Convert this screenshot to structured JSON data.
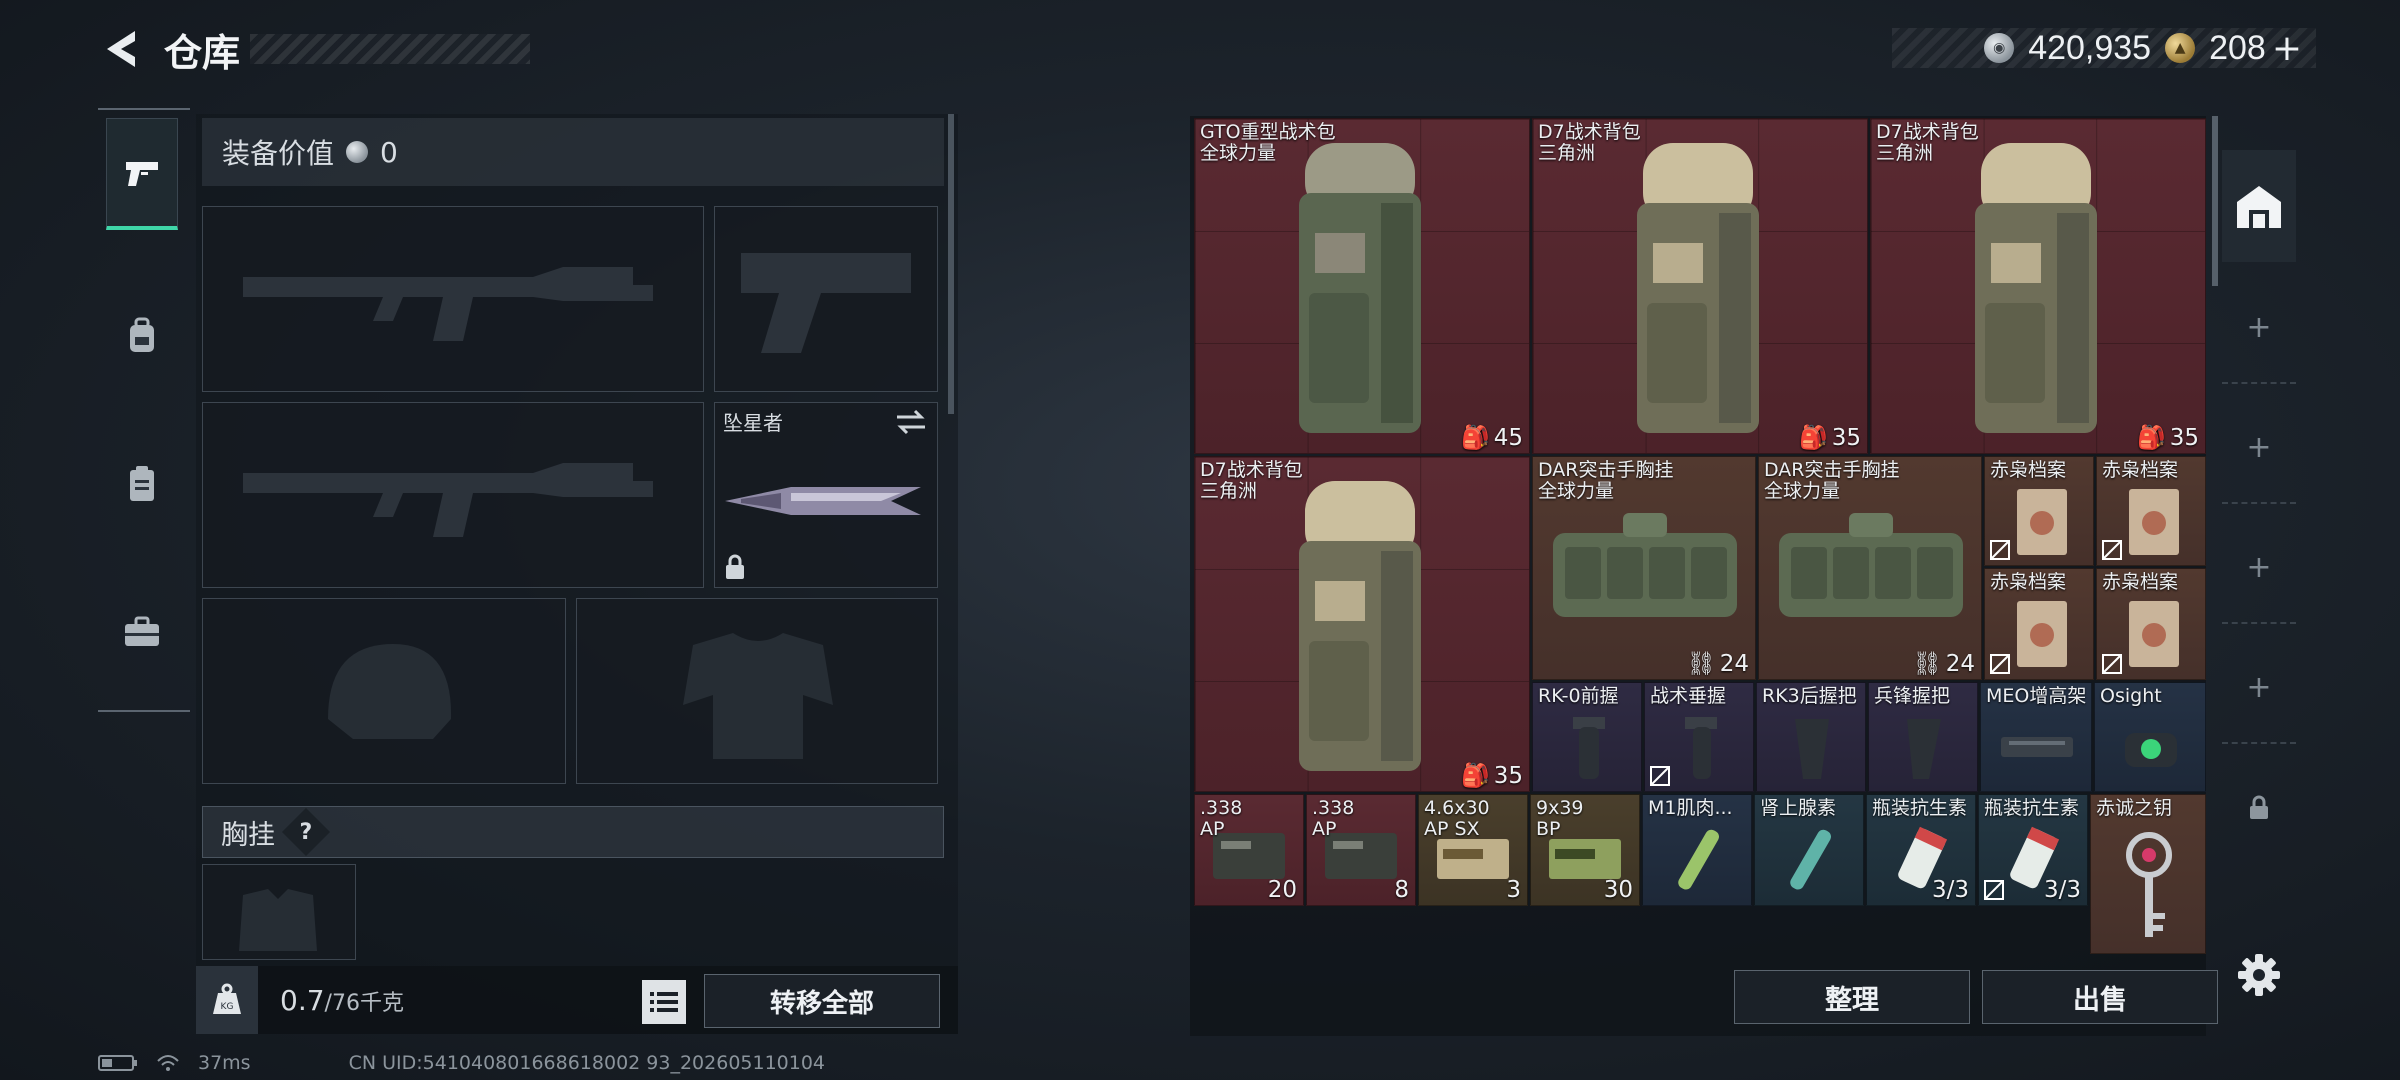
{
  "header": {
    "title": "仓库",
    "currencies": [
      {
        "icon": "silver-coin-icon",
        "value": "420,935"
      },
      {
        "icon": "gold-coin-icon",
        "value": "208"
      }
    ],
    "add_label": "+"
  },
  "loadout": {
    "value_label": "装备价值",
    "value": "0",
    "melee_name": "坠星者",
    "chest_rig_label": "胸挂",
    "help_label": "?",
    "weight_current": "0.7",
    "weight_max": "/76千克",
    "transfer_all": "转移全部"
  },
  "stash": {
    "items": [
      {
        "name": "GTO重型战术包",
        "sub": "全球力量",
        "count": "45",
        "count_icon": "backpack-icon",
        "color": "red"
      },
      {
        "name": "D7战术背包",
        "sub": "三角洲",
        "count": "35",
        "count_icon": "backpack-icon",
        "color": "red"
      },
      {
        "name": "D7战术背包",
        "sub": "三角洲",
        "count": "35",
        "count_icon": "backpack-icon",
        "color": "red"
      },
      {
        "name": "D7战术背包",
        "sub": "三角洲",
        "count": "35",
        "count_icon": "backpack-icon",
        "color": "red"
      },
      {
        "name": "DAR突击手胸挂",
        "sub": "全球力量",
        "count": "24",
        "count_icon": "vest-icon",
        "color": "brown"
      },
      {
        "name": "DAR突击手胸挂",
        "sub": "全球力量",
        "count": "24",
        "count_icon": "vest-icon",
        "color": "brown"
      },
      {
        "name": "赤枭档案",
        "color": "brown"
      },
      {
        "name": "赤枭档案",
        "color": "brown"
      },
      {
        "name": "赤枭档案",
        "color": "brown"
      },
      {
        "name": "赤枭档案",
        "color": "brown"
      },
      {
        "name": "RK-0前握",
        "color": "purple"
      },
      {
        "name": "战术垂握",
        "color": "purple"
      },
      {
        "name": "RK3后握把",
        "color": "purple"
      },
      {
        "name": "兵锋握把",
        "color": "purple"
      },
      {
        "name": "MEO增高架",
        "color": "blue"
      },
      {
        "name": "Osight",
        "color": "blue"
      },
      {
        "name": ".338",
        "sub": "AP",
        "count": "20",
        "color": "red"
      },
      {
        "name": ".338",
        "sub": "AP",
        "count": "8",
        "color": "red"
      },
      {
        "name": "4.6x30",
        "sub": "AP SX",
        "count": "3",
        "color": "gold"
      },
      {
        "name": "9x39",
        "sub": "BP",
        "count": "30",
        "color": "gold"
      },
      {
        "name": "M1肌肉...",
        "color": "blue"
      },
      {
        "name": "肾上腺素",
        "color": "teal"
      },
      {
        "name": "瓶装抗生素",
        "count": "3/3",
        "color": "teal"
      },
      {
        "name": "瓶装抗生素",
        "count": "3/3",
        "color": "teal"
      },
      {
        "name": "赤诚之钥",
        "color": "brown"
      }
    ],
    "sort_label": "整理",
    "sell_label": "出售"
  },
  "status_bar": {
    "ping": "37ms",
    "uid": "CN UID:541040801668618002 93_202605110104"
  },
  "colors": {
    "accent": "#3fd6a8",
    "red_rarity": "#5a2a32",
    "gold_rarity": "#4a3f2c",
    "blue_rarity": "#253245",
    "purple_rarity": "#2f2b43"
  }
}
